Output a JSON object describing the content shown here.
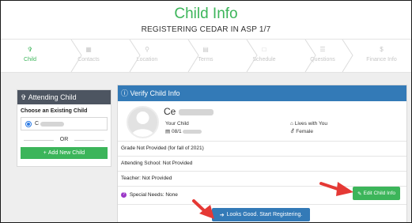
{
  "header": {
    "title": "Child Info",
    "subtitle": "REGISTERING CEDAR IN ASP 1/7"
  },
  "steps": [
    {
      "label": "Child",
      "icon": "child-icon",
      "active": true
    },
    {
      "label": "Contacts",
      "icon": "contacts-icon",
      "active": false
    },
    {
      "label": "Location",
      "icon": "location-icon",
      "active": false
    },
    {
      "label": "Terms",
      "icon": "terms-icon",
      "active": false
    },
    {
      "label": "Schedule",
      "icon": "calendar-icon",
      "active": false
    },
    {
      "label": "Questions",
      "icon": "questions-icon",
      "active": false
    },
    {
      "label": "Finance Info",
      "icon": "dollar-icon",
      "active": false
    }
  ],
  "attending": {
    "title": "Attending Child",
    "choose_label": "Choose an Existing Child",
    "selected_child": "C",
    "or_text": "OR",
    "add_button": "Add New Child"
  },
  "verify": {
    "title": "Verify Child Info",
    "name": "Ce",
    "relation": "Your Child",
    "dob": "08/1",
    "lives_with": "Lives with You",
    "gender": "Female",
    "grade": "Grade Not Provided (for fall of 2021)",
    "school": "Attending School:  Not Provided",
    "teacher": "Teacher:  Not Provided",
    "special_needs": "Special Needs:  None",
    "edit_button": "Edit Child Info",
    "confirm_button": "Looks Good. Start Registering."
  },
  "colors": {
    "accent_green": "#3cb55a",
    "accent_blue": "#337ab7",
    "dark_header": "#4d5561",
    "arrow_red": "#e53935"
  }
}
